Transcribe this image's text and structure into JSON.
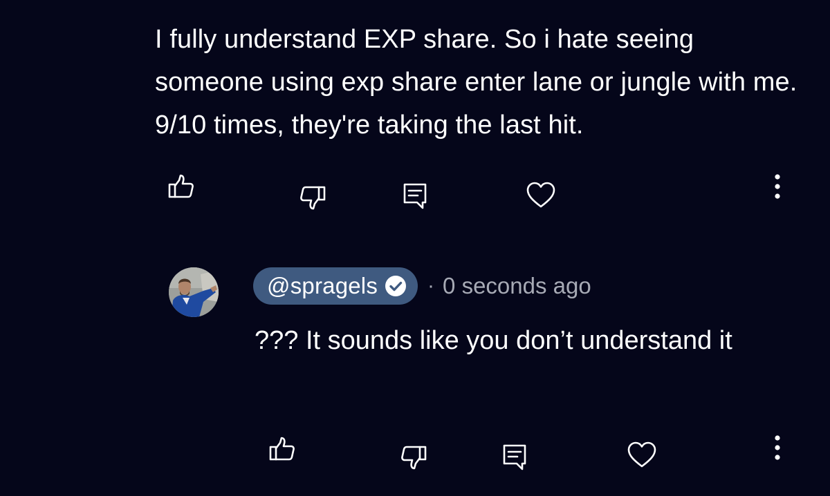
{
  "colors": {
    "background": "#05061a",
    "text": "#ffffff",
    "muted": "#a7aab5",
    "handle_pill": "#3f5a80"
  },
  "comment": {
    "text": "I fully understand EXP share. So i hate seeing someone using exp share enter lane or jungle with me. 9/10 times, they're taking the last hit.",
    "actions": {
      "like_icon": "thumbs-up-icon",
      "dislike_icon": "thumbs-down-icon",
      "reply_icon": "comment-icon",
      "heart_icon": "heart-icon",
      "more_icon": "more-vertical-icon"
    }
  },
  "reply": {
    "handle": "@spragels",
    "verified": true,
    "separator": "·",
    "timestamp": "0 seconds ago",
    "text": "??? It sounds like you don’t understand it",
    "actions": {
      "like_icon": "thumbs-up-icon",
      "dislike_icon": "thumbs-down-icon",
      "reply_icon": "comment-icon",
      "heart_icon": "heart-icon",
      "more_icon": "more-vertical-icon"
    }
  }
}
